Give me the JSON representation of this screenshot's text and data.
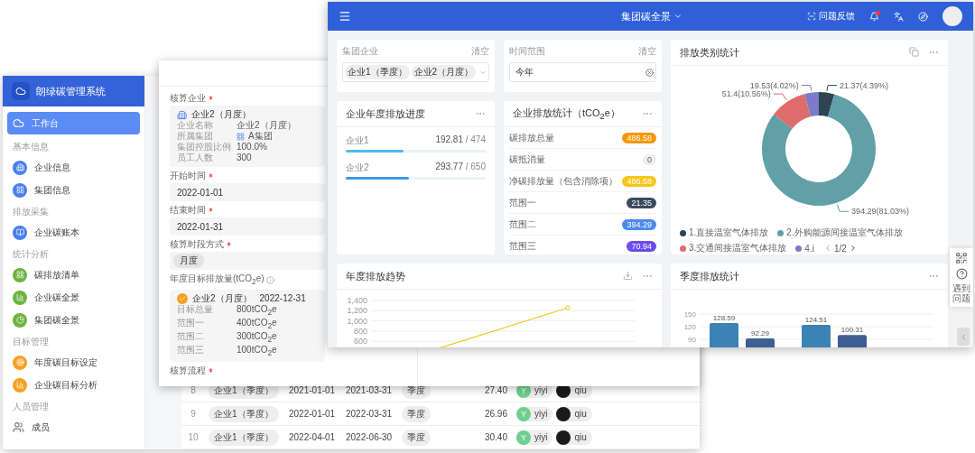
{
  "sidebar_window": {
    "app_title": "朗绿碳管理系统",
    "menu": [
      {
        "kind": "link",
        "label": "工作台",
        "selected": true
      },
      {
        "kind": "section",
        "label": "基本信息"
      },
      {
        "kind": "item",
        "label": "企业信息",
        "selected": false,
        "color": "#4a7ff0"
      },
      {
        "kind": "item",
        "label": "集团信息",
        "selected": false,
        "color": "#4a7ff0"
      },
      {
        "kind": "section",
        "label": "排放采集"
      },
      {
        "kind": "item",
        "label": "企业碳账本",
        "selected": false,
        "color": "#4a7ff0"
      },
      {
        "kind": "section",
        "label": "统计分析"
      },
      {
        "kind": "item",
        "label": "碳排放清单",
        "selected": false,
        "color": "#6db33f"
      },
      {
        "kind": "item",
        "label": "企业碳全景",
        "selected": false,
        "color": "#6db33f"
      },
      {
        "kind": "item",
        "label": "集团碳全景",
        "selected": false,
        "color": "#6db33f"
      },
      {
        "kind": "section",
        "label": "目标管理"
      },
      {
        "kind": "item",
        "label": "年度碳目标设定",
        "selected": false,
        "color": "#f5a020"
      },
      {
        "kind": "item",
        "label": "企业碳目标分析",
        "selected": false,
        "color": "#f5a020"
      },
      {
        "kind": "section",
        "label": "人员管理"
      },
      {
        "kind": "link",
        "label": "成员",
        "selected": false
      }
    ],
    "table_rows": [
      {
        "index": "8",
        "enterprise": "企业1（季度）",
        "start": "2021-01-01",
        "end": "2021-03-31",
        "period": "季度",
        "value": "27.40",
        "users": [
          {
            "initial": "Y",
            "name": "yiyi",
            "color": "#6fcf8f"
          },
          {
            "name": "qiu",
            "color": "#1a1a1a"
          }
        ]
      },
      {
        "index": "9",
        "enterprise": "企业1（季度）",
        "start": "2022-01-01",
        "end": "2022-03-31",
        "period": "季度",
        "value": "26.96",
        "users": [
          {
            "initial": "Y",
            "name": "yiyi",
            "color": "#6fcf8f"
          },
          {
            "name": "qiu",
            "color": "#1a1a1a"
          }
        ]
      },
      {
        "index": "10",
        "enterprise": "企业1（季度）",
        "start": "2022-04-01",
        "end": "2022-06-30",
        "period": "季度",
        "value": "30.40",
        "users": [
          {
            "initial": "Y",
            "name": "yiyi",
            "color": "#6fcf8f"
          },
          {
            "name": "qiu",
            "color": "#1a1a1a"
          }
        ]
      }
    ]
  },
  "form_window": {
    "fields": [
      {
        "kind": "enterprise",
        "label": "核算企业",
        "required": true,
        "title": "企业2（月度）",
        "rows": [
          {
            "kind": "plain",
            "key": "企业名称",
            "value": "企业2（月度）"
          },
          {
            "kind": "group",
            "key": "所属集团",
            "value": "A集团"
          },
          {
            "kind": "plain",
            "key": "集团控股比例",
            "value": "100.0%"
          },
          {
            "kind": "plain",
            "key": "员工人数",
            "value": "300"
          }
        ]
      },
      {
        "kind": "text",
        "label": "开始时间",
        "required": true,
        "value": "2022-01-01"
      },
      {
        "kind": "text",
        "label": "结束时间",
        "required": true,
        "value": "2022-01-31"
      },
      {
        "kind": "tag",
        "label": "核算时段方式",
        "required": true,
        "value": "月度"
      },
      {
        "kind": "target",
        "label": "年度目标排放量(tCO$_{2}$e)",
        "required": false,
        "info": true,
        "checked": true,
        "title": "企业2（月度）",
        "date": "2022-12-31",
        "rows": [
          {
            "kind": "plain",
            "key": "目标总量",
            "value": "800tCO$_{2}$e"
          },
          {
            "kind": "plain",
            "key": "范围一",
            "value": "400tCO$_{2}$e"
          },
          {
            "kind": "plain",
            "key": "范围二",
            "value": "300tCO$_{2}$e"
          },
          {
            "kind": "plain",
            "key": "范围三",
            "value": "100tCO$_{2}$e"
          }
        ]
      },
      {
        "kind": "label",
        "label": "核算流程",
        "required": true
      }
    ]
  },
  "dashboard": {
    "topbar": {
      "title": "集团碳全景",
      "feedback": "问题反馈",
      "notification": true
    },
    "filters": [
      {
        "kind": "tags",
        "label": "集团企业",
        "clear": "清空",
        "tags": [
          "企业1（季度）",
          "企业2（月度）"
        ]
      },
      {
        "kind": "value",
        "label": "时间范围",
        "clear": "清空",
        "value": "今年"
      }
    ],
    "progress": {
      "title": "企业年度排放进度",
      "rows": [
        {
          "name": "企业1",
          "value": "192.81",
          "total": "/ 474",
          "level": 0.41,
          "color": "#4dbbef"
        },
        {
          "name": "企业2",
          "value": "293.77",
          "total": "/ 650",
          "level": 0.45,
          "color": "#3a9bea"
        }
      ]
    },
    "stats": {
      "title": "企业排放统计（tCO$_{2}$e）",
      "rows": [
        {
          "label": "碳排放总量",
          "value": "486.58",
          "color": "#f5980c"
        },
        {
          "label": "碳抵消量",
          "value": "0",
          "color": "#eeeeee"
        },
        {
          "label": "净碳排放量（包含消除项）",
          "value": "486.58",
          "color": "#f8c518"
        },
        {
          "label": "范围一",
          "value": "21.35",
          "color": "#3a4a5e"
        },
        {
          "label": "范围二",
          "value": "394.29",
          "color": "#4d8af0"
        },
        {
          "label": "范围三",
          "value": "70.94",
          "color": "#6a4cf0"
        }
      ]
    },
    "trend": {
      "title": "年度排放趋势",
      "y_labels": [
        "1,400",
        "1,200",
        "1,000",
        "800",
        "600"
      ]
    },
    "category": {
      "title": "排放类别统计",
      "legend_page": "1/2",
      "chart_data": {
        "type": "donut",
        "categories": [
          "1.直接温室气体排放",
          "2.外购能源间接温室气体排放",
          "3.交通间接温室气体排放",
          "4.i"
        ],
        "values": [
          21.37,
          394.29,
          51.4,
          19.53
        ],
        "value_labels": [
          "21.37(4.39%)",
          "394.29(81.03%)",
          "51.4(10.56%)",
          "19.53(4.02%)"
        ]
      }
    },
    "quarterly": {
      "title": "季度排放统计",
      "y_labels": [
        "150",
        "120",
        "90"
      ],
      "bars": [
        {
          "label": "128.59",
          "color": "#3b82b5"
        },
        {
          "label": "92.29",
          "color": "#3f5e96"
        },
        {
          "label": "124.51",
          "color": "#3b82b5"
        },
        {
          "label": "100.31",
          "color": "#3f5e96"
        }
      ]
    },
    "side_tools": {
      "help": "遇到问题"
    }
  }
}
